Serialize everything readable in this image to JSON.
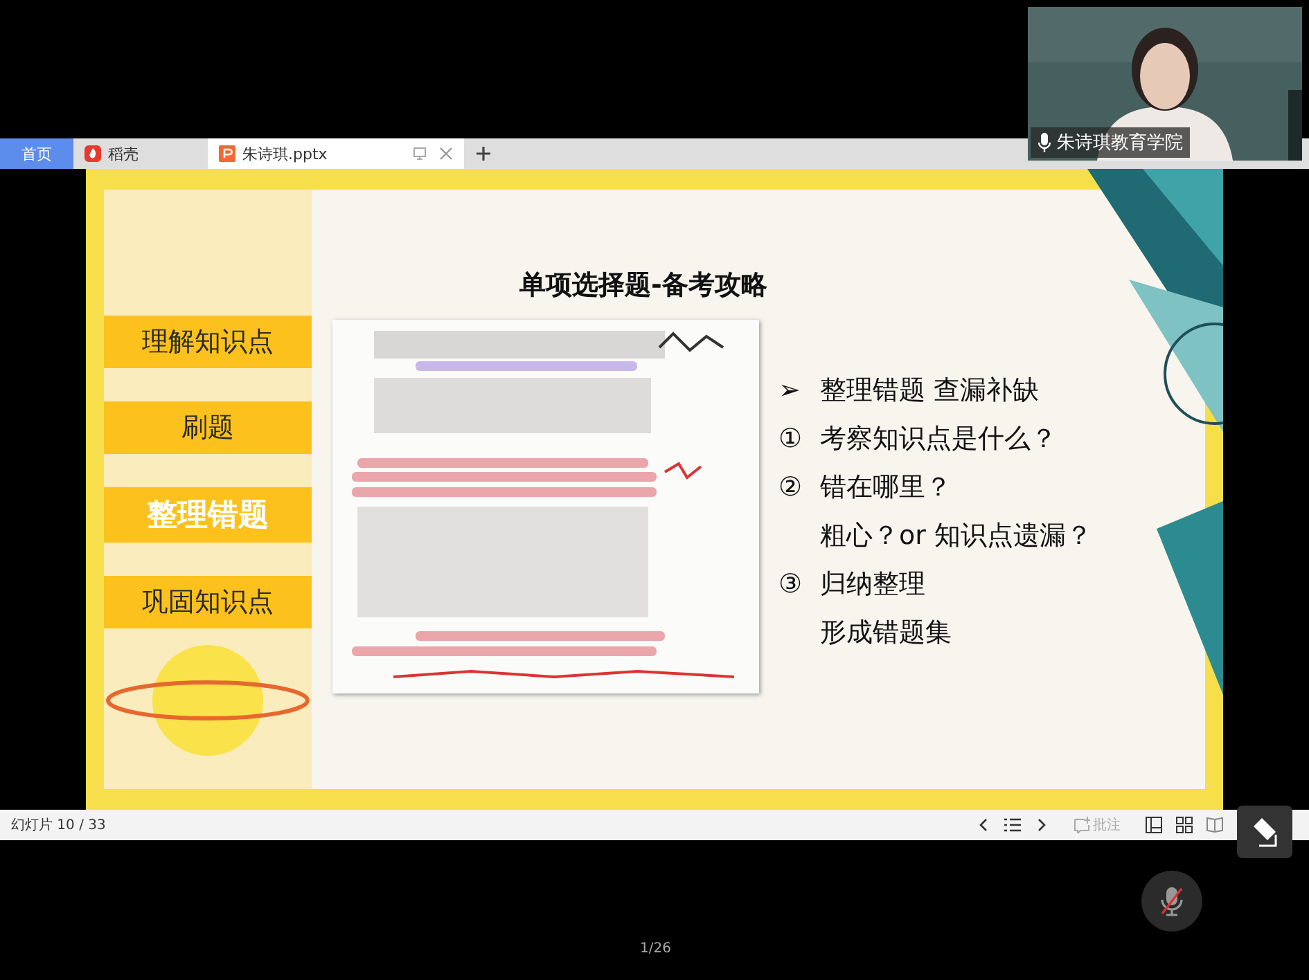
{
  "video": {
    "name": "朱诗琪教育学院",
    "kind": "picture"
  },
  "tabs": [
    {
      "label": "首页",
      "kind": "home",
      "selected": false
    },
    {
      "label": "稻壳",
      "kind": "docer",
      "selected": false
    },
    {
      "label": "朱诗琪.pptx",
      "kind": "file",
      "selected": true
    }
  ],
  "slide": {
    "title": "单项选择题-备考攻略",
    "menu": [
      {
        "label": "理解知识点",
        "selected": false
      },
      {
        "label": "刷题",
        "selected": false
      },
      {
        "label": "整理错题",
        "selected": true
      },
      {
        "label": "巩固知识点",
        "selected": false
      }
    ],
    "points": [
      {
        "marker": "➢",
        "text": "整理错题  查漏补缺"
      },
      {
        "marker": "①",
        "text": "考察知识点是什么？"
      },
      {
        "marker": "②",
        "text": "错在哪里？"
      },
      {
        "text": "粗心？or  知识点遗漏？"
      },
      {
        "marker": "③",
        "text": "归纳整理"
      },
      {
        "text": "形成错题集"
      }
    ]
  },
  "status_bar": {
    "slide_counter": "幻灯片 10 / 33",
    "comment": "批注"
  },
  "mic": {
    "muted": true
  },
  "page_indicator": "1/26"
}
